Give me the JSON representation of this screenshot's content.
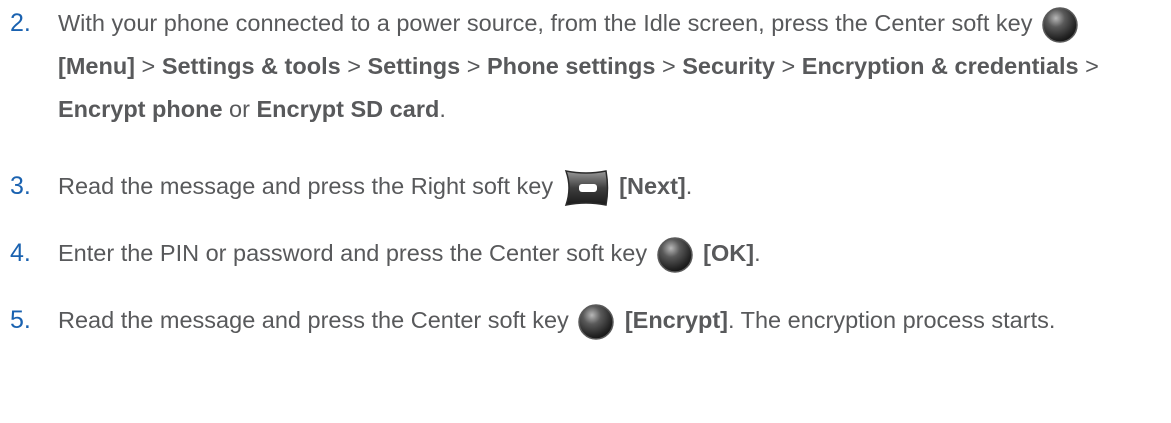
{
  "steps": [
    {
      "number": "2.",
      "intro": "With your phone connected to a power source, from the Idle screen, press the Center soft key",
      "key_icon": "center-soft-key-icon",
      "menu": "[Menu]",
      "sep": ">",
      "path": [
        "Settings & tools",
        "Settings",
        "Phone settings",
        "Security",
        "Encryption & credentials",
        "Encrypt phone"
      ],
      "or": "or",
      "last": "Encrypt SD card",
      "end": "."
    },
    {
      "number": "3.",
      "intro": "Read the message and press the Right soft key",
      "key_icon": "right-soft-key-icon",
      "action": "[Next]",
      "end": "."
    },
    {
      "number": "4.",
      "intro": "Enter the PIN or password and press the Center soft key",
      "key_icon": "center-soft-key-icon",
      "action": "[OK]",
      "end": "."
    },
    {
      "number": "5.",
      "intro": "Read the message and press the Center soft key",
      "key_icon": "center-soft-key-icon",
      "action": "[Encrypt]",
      "rest": ". The encryption process starts."
    }
  ],
  "colors": {
    "number": "#1a62b0",
    "text": "#58595b",
    "bold": "#58595b"
  }
}
